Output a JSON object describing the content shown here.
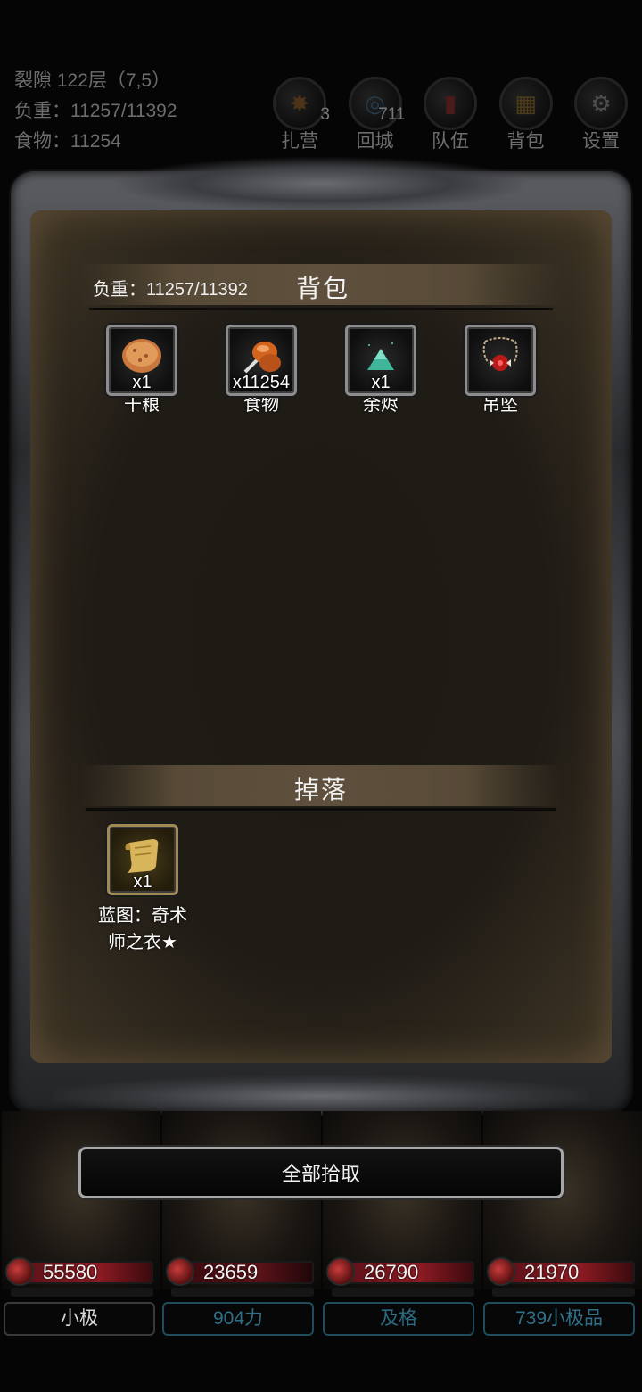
{
  "hud": {
    "floor": "裂隙 122层（7,5）",
    "load": "负重：11257/11392",
    "food": "食物：11254",
    "buttons": [
      {
        "label": "扎营",
        "badge": "3",
        "icon": "campfire-icon"
      },
      {
        "label": "回城",
        "badge": "711",
        "icon": "portal-icon"
      },
      {
        "label": "队伍",
        "badge": "",
        "icon": "banner-icon"
      },
      {
        "label": "背包",
        "badge": "",
        "icon": "chest-icon"
      },
      {
        "label": "设置",
        "badge": "",
        "icon": "gear-icon"
      }
    ]
  },
  "bag": {
    "weight": "负重：11257/11392",
    "title": "背包",
    "items": [
      {
        "name": "干粮",
        "qty": "x1",
        "icon": "bread-icon"
      },
      {
        "name": "食物",
        "qty": "x11254",
        "icon": "meat-icon"
      },
      {
        "name": "余烬",
        "qty": "x1",
        "icon": "ember-icon"
      },
      {
        "name": "吊坠",
        "qty": "",
        "icon": "pendant-icon"
      }
    ]
  },
  "drops": {
    "title": "掉落",
    "items": [
      {
        "name": "蓝图：奇术师之衣★",
        "qty": "x1",
        "icon": "scroll-icon"
      }
    ]
  },
  "pickup_label": "全部拾取",
  "party": [
    {
      "hp": "55580",
      "name": "小极"
    },
    {
      "hp": "23659",
      "name": "904力"
    },
    {
      "hp": "26790",
      "name": "及格"
    },
    {
      "hp": "21970",
      "name": "739小极品"
    }
  ]
}
